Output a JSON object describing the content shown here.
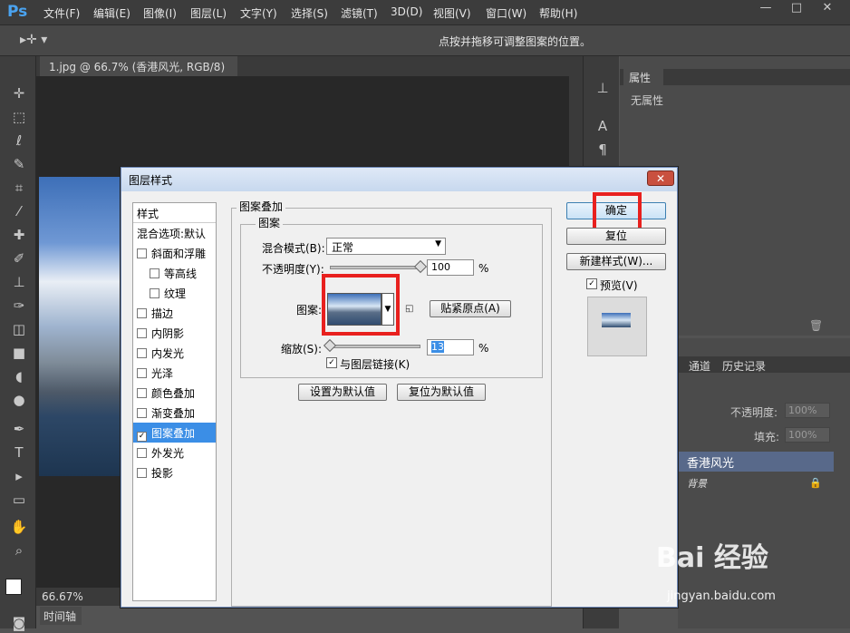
{
  "app": {
    "logo": "Ps"
  },
  "menu": [
    "文件(F)",
    "编辑(E)",
    "图像(I)",
    "图层(L)",
    "文字(Y)",
    "选择(S)",
    "滤镜(T)",
    "3D(D)",
    "视图(V)",
    "窗口(W)",
    "帮助(H)"
  ],
  "window_controls": {
    "minimize": "—",
    "restore": "□",
    "close": "✕"
  },
  "options_bar": {
    "hint": "点按并拖移可调整图案的位置。"
  },
  "document": {
    "tab_title": "1.jpg @ 66.7% (香港风光, RGB/8) *",
    "zoom": "66.67%",
    "timeline_tab": "时间轴"
  },
  "properties_panel": {
    "tab": "属性",
    "content": "无属性"
  },
  "layers_panel": {
    "tabs": [
      "通道",
      "历史记录"
    ],
    "opacity_label": "不透明度:",
    "opacity_value": "100%",
    "fill_label": "填充:",
    "fill_value": "100%",
    "layers": [
      "香港风光",
      "背景"
    ]
  },
  "dialog": {
    "title": "图层样式",
    "close": "✕",
    "style_header": "样式",
    "styles": [
      {
        "label": "混合选项:默认",
        "checkbox": false,
        "indent": false
      },
      {
        "label": "斜面和浮雕",
        "checkbox": true,
        "checked": false,
        "indent": false
      },
      {
        "label": "等高线",
        "checkbox": true,
        "checked": false,
        "indent": true
      },
      {
        "label": "纹理",
        "checkbox": true,
        "checked": false,
        "indent": true
      },
      {
        "label": "描边",
        "checkbox": true,
        "checked": false,
        "indent": false
      },
      {
        "label": "内阴影",
        "checkbox": true,
        "checked": false,
        "indent": false
      },
      {
        "label": "内发光",
        "checkbox": true,
        "checked": false,
        "indent": false
      },
      {
        "label": "光泽",
        "checkbox": true,
        "checked": false,
        "indent": false
      },
      {
        "label": "颜色叠加",
        "checkbox": true,
        "checked": false,
        "indent": false
      },
      {
        "label": "渐变叠加",
        "checkbox": true,
        "checked": false,
        "indent": false
      },
      {
        "label": "图案叠加",
        "checkbox": true,
        "checked": true,
        "indent": false,
        "selected": true
      },
      {
        "label": "外发光",
        "checkbox": true,
        "checked": false,
        "indent": false
      },
      {
        "label": "投影",
        "checkbox": true,
        "checked": false,
        "indent": false
      }
    ],
    "group_title": "图案叠加",
    "sub_title": "图案",
    "blend_label": "混合模式(B):",
    "blend_value": "正常",
    "opacity_label": "不透明度(Y):",
    "opacity_value": "100",
    "opacity_level": 1.0,
    "percent": "%",
    "pattern_label": "图案:",
    "snap_button": "贴紧原点(A)",
    "scale_label": "缩放(S):",
    "scale_value": "13",
    "scale_level": 0.0,
    "link_label": "与图层链接(K)",
    "link_checked": "✓",
    "set_default": "设置为默认值",
    "reset_default": "复位为默认值",
    "ok": "确定",
    "reset": "复位",
    "new_style": "新建样式(W)...",
    "preview_label": "预览(V)",
    "preview_checked": "✓"
  },
  "watermark": {
    "brand": "Bai 经验",
    "url": "jingyan.baidu.com"
  },
  "highlight_color": "#e8201e"
}
